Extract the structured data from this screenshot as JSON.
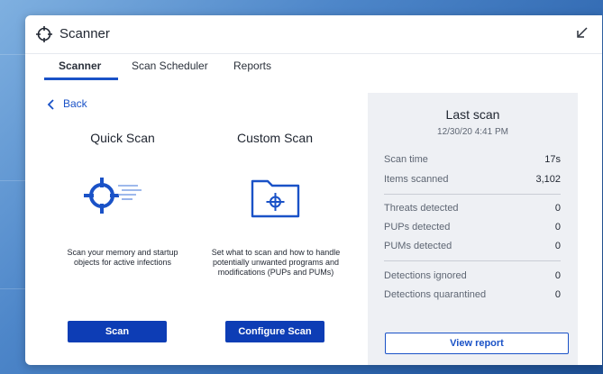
{
  "app": {
    "title": "Scanner"
  },
  "tabs": [
    {
      "label": "Scanner",
      "active": true
    },
    {
      "label": "Scan Scheduler"
    },
    {
      "label": "Reports"
    }
  ],
  "back": {
    "label": "Back"
  },
  "quick_scan": {
    "title": "Quick Scan",
    "description_line1": "Scan your memory and startup",
    "description_line2": "objects for active infections",
    "button": "Scan",
    "icon": "crosshair-speed-icon"
  },
  "custom_scan": {
    "title": "Custom Scan",
    "description_line1": "Set what to scan and how to handle",
    "description_line2": "potentially unwanted programs and",
    "description_line3": "modifications (PUPs and PUMs)",
    "button": "Configure Scan",
    "icon": "folder-crosshair-icon"
  },
  "last_scan": {
    "title": "Last scan",
    "date": "12/30/20 4:41 PM",
    "rows": [
      {
        "label": "Scan time",
        "value": "17s"
      },
      {
        "label": "Items scanned",
        "value": "3,102"
      },
      {
        "label": "Threats detected",
        "value": "0"
      },
      {
        "label": "PUPs detected",
        "value": "0"
      },
      {
        "label": "PUMs detected",
        "value": "0"
      },
      {
        "label": "Detections ignored",
        "value": "0"
      },
      {
        "label": "Detections quarantined",
        "value": "0"
      }
    ],
    "button": "View report"
  },
  "colors": {
    "accent": "#1a52c7",
    "button": "#0d3db5",
    "panel": "#eef0f4"
  }
}
